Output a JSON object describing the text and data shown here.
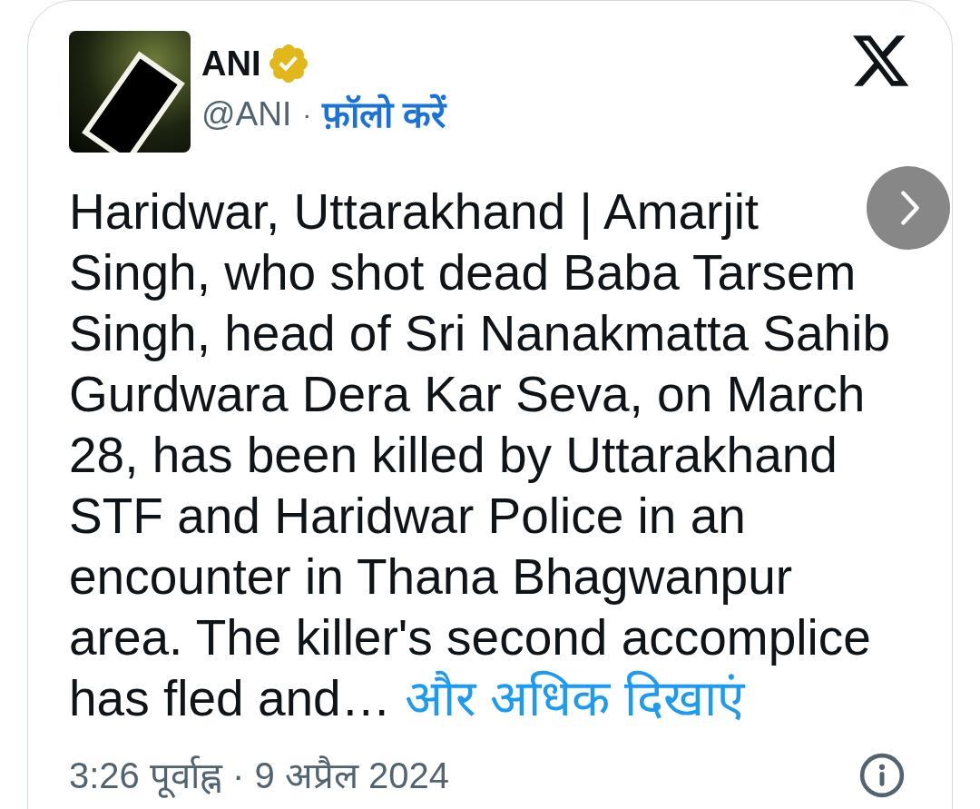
{
  "tweet": {
    "author": {
      "name": "ANI",
      "verified": true,
      "handle": "@ANI",
      "separator": "·",
      "follow_label": "फ़ॉलो करें"
    },
    "text": "Haridwar, Uttarakhand | Amarjit Singh, who shot dead Baba Tarsem Singh, head of Sri Nanakmatta Sahib Gurdwara Dera Kar Seva, on March 28, has been killed by Uttarakhand STF and Haridwar Police in an encounter in Thana Bhagwanpur area. The killer's second accomplice has fled and…",
    "show_more": "और अधिक दिखाएं",
    "timestamp": "3:26 पूर्वाह्न · 9 अप्रैल 2024"
  }
}
